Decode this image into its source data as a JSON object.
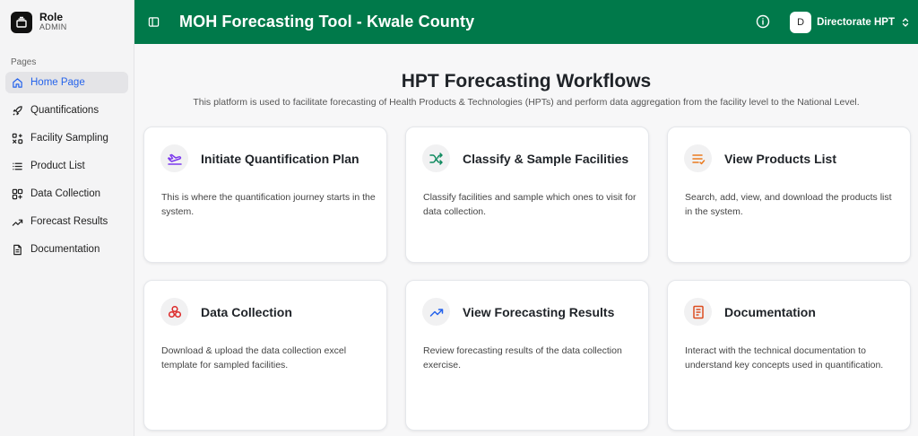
{
  "sidebar": {
    "role_title": "Role",
    "role_subtitle": "ADMIN",
    "pages_label": "Pages",
    "items": [
      {
        "label": "Home Page",
        "icon": "home-icon"
      },
      {
        "label": "Quantifications",
        "icon": "rocket-icon"
      },
      {
        "label": "Facility Sampling",
        "icon": "sampling-icon"
      },
      {
        "label": "Product List",
        "icon": "list-icon"
      },
      {
        "label": "Data Collection",
        "icon": "grid-plus-icon"
      },
      {
        "label": "Forecast Results",
        "icon": "trend-icon"
      },
      {
        "label": "Documentation",
        "icon": "document-icon"
      }
    ]
  },
  "header": {
    "title": "MOH Forecasting Tool - Kwale County",
    "user_initial": "D",
    "user_name": "Directorate HPT"
  },
  "main": {
    "title": "HPT Forecasting Workflows",
    "description": "This platform is used to facilitate forecasting of Health Products & Technologies (HPTs) and perform data aggregation from the facility level to the National Level.",
    "cards": [
      {
        "title": "Initiate Quantification Plan",
        "description": "This is where the quantification journey starts in the system.",
        "icon": "plane-icon",
        "color": "#7c3aed"
      },
      {
        "title": "Classify & Sample Facilities",
        "description": "Classify facilities and sample which ones to visit for data collection.",
        "icon": "shuffle-icon",
        "color": "#0f8a5f"
      },
      {
        "title": "View Products List",
        "description": "Search, add, view, and download the products list in the system.",
        "icon": "list-check-icon",
        "color": "#ea7a1f"
      },
      {
        "title": "Data Collection",
        "description": "Download & upload the data collection excel template for sampled facilities.",
        "icon": "cells-icon",
        "color": "#dc2626"
      },
      {
        "title": "View Forecasting Results",
        "description": "Review forecasting results of the data collection exercise.",
        "icon": "trend-up-icon",
        "color": "#2563eb"
      },
      {
        "title": "Documentation",
        "description": "Interact with the technical documentation to understand key concepts used in quantification.",
        "icon": "book-icon",
        "color": "#dc4c1f"
      }
    ]
  }
}
